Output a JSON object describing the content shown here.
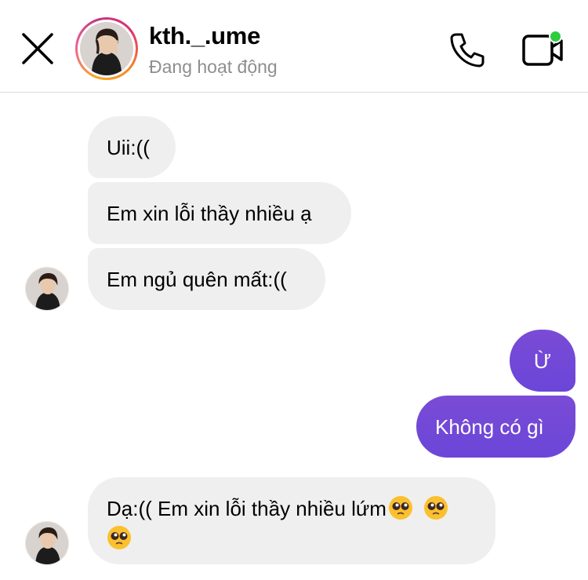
{
  "header": {
    "username": "kth._.ume",
    "status": "Đang hoạt động",
    "icons": [
      "close-icon",
      "phone-icon",
      "video-camera-icon",
      "online-dot"
    ]
  },
  "messages": [
    {
      "direction": "incoming",
      "text": "Uii:(("
    },
    {
      "direction": "incoming",
      "text": "Em xin lỗi thầy nhiều ạ"
    },
    {
      "direction": "incoming",
      "text": "Em ngủ quên mất:(("
    },
    {
      "direction": "outgoing",
      "text": "Ừ"
    },
    {
      "direction": "outgoing",
      "text": "Không có gì"
    },
    {
      "direction": "incoming",
      "text_line1": "Dạ:(( Em xin lỗi thầy nhiều lứm",
      "emoji": "pleading-face-emoji"
    }
  ],
  "colors": {
    "incoming_bubble": "#efefef",
    "outgoing_bubble": "#6b46d8",
    "online_dot": "#2ecc40",
    "status_text": "#8e8e8e"
  }
}
